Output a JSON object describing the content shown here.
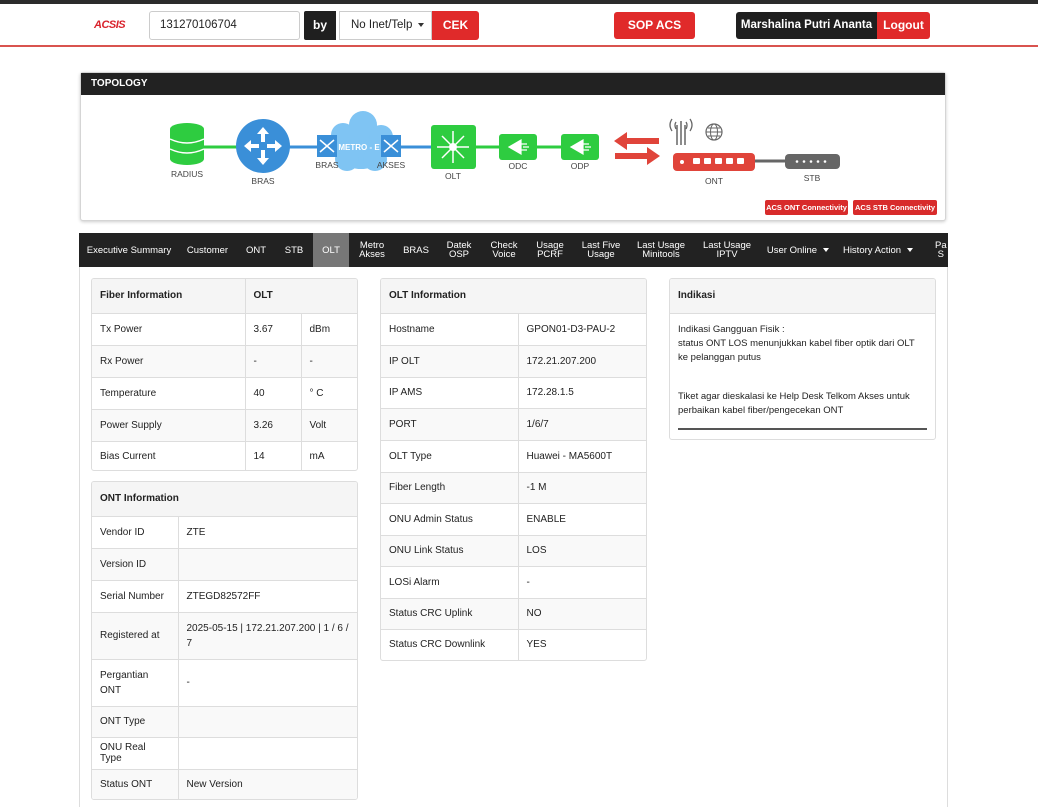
{
  "header": {
    "logo_text": "ACSIS",
    "search_value": "131270106704",
    "by_label": "by",
    "search_mode": "No Inet/Telp",
    "cek_label": "CEK",
    "sop_label": "SOP ACS",
    "user_name": "Marshalina Putri Ananta",
    "logout_label": "Logout"
  },
  "topology": {
    "title": "TOPOLOGY",
    "nodes": {
      "radius": "RADIUS",
      "bras": "BRAS",
      "metro_cloud": "METRO - E",
      "bras2": "BRAS",
      "akses": "AKSES",
      "olt": "OLT",
      "odc": "ODC",
      "odp": "ODP",
      "ont": "ONT",
      "stb": "STB"
    },
    "acs_ont_label": "ACS ONT Connectivity",
    "acs_stb_label": "ACS STB Connectivity",
    "colors": {
      "green": "#2ecc40",
      "blue": "#3a8fd8",
      "red": "#e0443a",
      "gray": "#666666"
    }
  },
  "tabs": [
    "Executive Summary",
    "Customer",
    "ONT",
    "STB",
    "OLT",
    "Metro\nAkses",
    "BRAS",
    "Datek\nOSP",
    "Check\nVoice",
    "Usage\nPCRF",
    "Last Five\nUsage",
    "Last Usage\nMinitools",
    "Last Usage\nIPTV",
    "User Online",
    "History Action",
    "Pa\nS"
  ],
  "active_tab": "OLT",
  "fiber": {
    "col1": "Fiber Information",
    "col2": "OLT",
    "rows": [
      {
        "label": "Tx Power",
        "value": "3.67",
        "unit": "dBm"
      },
      {
        "label": "Rx Power",
        "value": "-",
        "unit": "-"
      },
      {
        "label": "Temperature",
        "value": "40",
        "unit": "° C"
      },
      {
        "label": "Power Supply",
        "value": "3.26",
        "unit": "Volt"
      },
      {
        "label": "Bias Current",
        "value": "14",
        "unit": "mA"
      }
    ]
  },
  "ont": {
    "title": "ONT Information",
    "rows": [
      {
        "label": "Vendor ID",
        "value": "ZTE"
      },
      {
        "label": "Version ID",
        "value": ""
      },
      {
        "label": "Serial Number",
        "value": "ZTEGD82572FF"
      },
      {
        "label": "Registered at",
        "value": "2025-05-15 | 172.21.207.200 | 1 / 6 / 7"
      },
      {
        "label": "Pergantian ONT",
        "value": "-"
      },
      {
        "label": "ONT Type",
        "value": ""
      },
      {
        "label": "ONU Real Type",
        "value": ""
      },
      {
        "label": "Status ONT",
        "value": "New Version"
      }
    ]
  },
  "olt": {
    "title": "OLT Information",
    "rows": [
      {
        "label": "Hostname",
        "value": "GPON01-D3-PAU-2"
      },
      {
        "label": "IP OLT",
        "value": "172.21.207.200"
      },
      {
        "label": "IP AMS",
        "value": "172.28.1.5"
      },
      {
        "label": "PORT",
        "value": "1/6/7"
      },
      {
        "label": "OLT Type",
        "value": "Huawei - MA5600T"
      },
      {
        "label": "Fiber Length",
        "value": "-1 M"
      },
      {
        "label": "ONU Admin Status",
        "value": "ENABLE"
      },
      {
        "label": "ONU Link Status",
        "value": "LOS"
      },
      {
        "label": "LOSi Alarm",
        "value": "-"
      },
      {
        "label": "Status CRC Uplink",
        "value": "NO"
      },
      {
        "label": "Status CRC Downlink",
        "value": "YES"
      }
    ]
  },
  "indikasi": {
    "title": "Indikasi",
    "line1": "Indikasi Gangguan Fisik :",
    "line2": "status ONT LOS menunjukkan kabel fiber optik dari OLT ke pelanggan putus",
    "line3": "Tiket agar dieskalasi ke Help Desk Telkom Akses untuk perbaikan kabel fiber/pengecekan ONT"
  }
}
